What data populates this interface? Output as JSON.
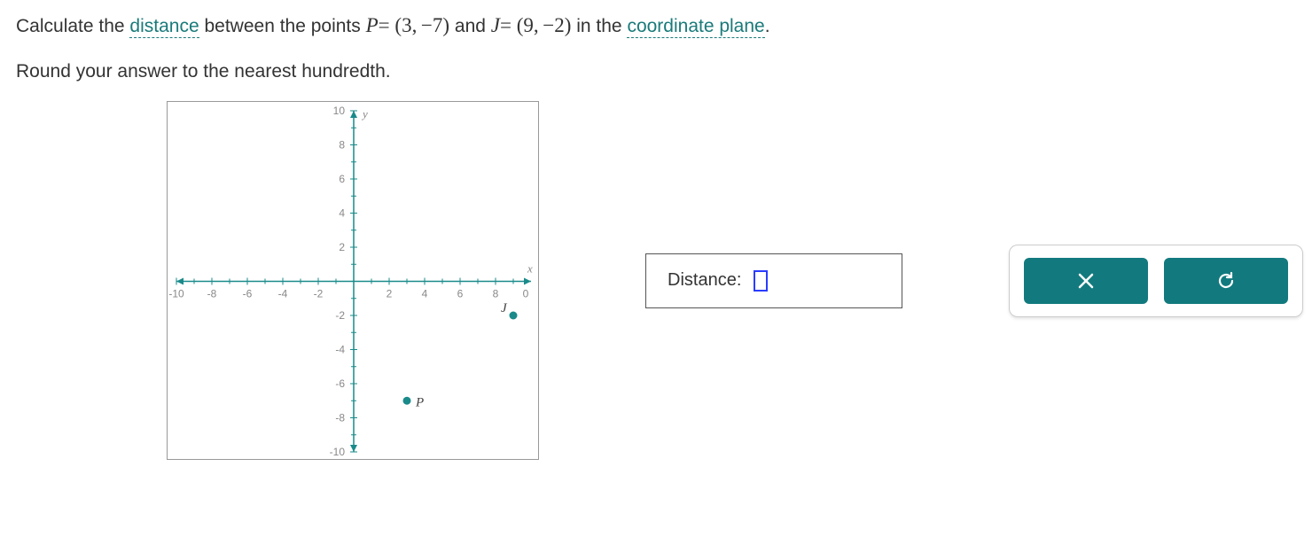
{
  "problem": {
    "line1_pre": "Calculate the ",
    "link1": "distance",
    "line1_mid": " between the points ",
    "P_var": "P",
    "P_eq": "= ",
    "P_coords": "(3, −7)",
    "and": " and ",
    "J_var": "J",
    "J_eq": "= ",
    "J_coords": "(9, −2)",
    "line1_post": " in the ",
    "link2": "coordinate plane",
    "line1_end": ".",
    "line2": "Round your answer to the nearest hundredth."
  },
  "answer": {
    "label": "Distance:",
    "value": ""
  },
  "chart_data": {
    "type": "scatter",
    "title": "",
    "xlabel": "x",
    "ylabel": "y",
    "xlim": [
      -10,
      10
    ],
    "ylim": [
      -10,
      10
    ],
    "x_ticks": [
      -10,
      -8,
      -6,
      -4,
      -2,
      2,
      4,
      6,
      8
    ],
    "y_ticks": [
      -10,
      -8,
      -6,
      -4,
      -2,
      2,
      4,
      6,
      8,
      10
    ],
    "points": [
      {
        "name": "P",
        "x": 3,
        "y": -7
      },
      {
        "name": "J",
        "x": 9,
        "y": -2
      }
    ],
    "origin_label": "0"
  },
  "icons": {
    "close": "close-icon",
    "reset": "reset-icon"
  }
}
